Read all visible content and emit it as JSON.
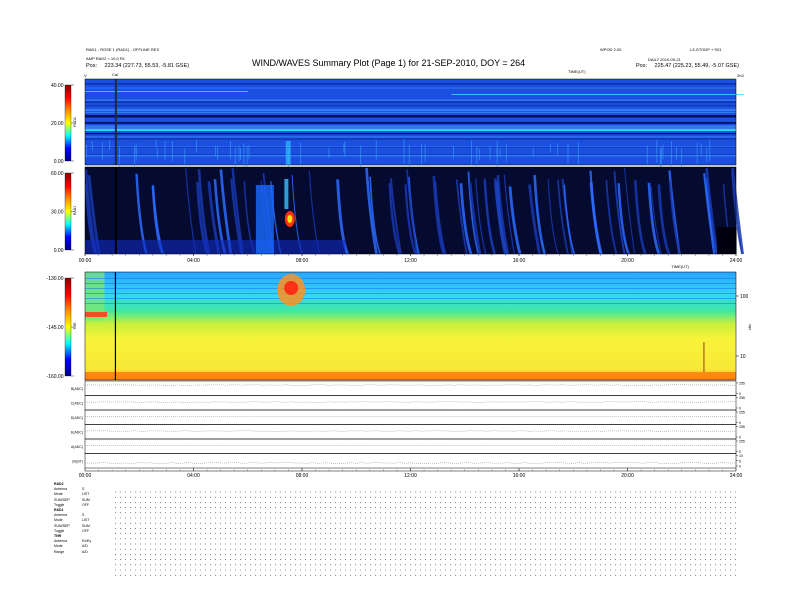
{
  "header": {
    "left_line1": "RAD1 - ROSE 1 (RAD1) - OFFLINE RES",
    "left_line2": "AMP RAD2 = 10.0 R1",
    "left_orbit_label": "Pos:",
    "left_orbit_value": "223.34 (227.73, 55.53, -5.81 GSE)",
    "title": "WIND/WAVES Summary Plot (Page 1) for 21-SEP-2010, DOY = 264",
    "right_line1": "WPOD 2.00",
    "right_line2": "DAILY 2010-09-21",
    "right_top_far": "L3-GTODP + S01",
    "right_orbit_label": "Pos:",
    "right_orbit_value": "225.47 (225.23, 55.49, -5.07 GSE)",
    "time_label": "TIME(UT)",
    "cal_marker": "Cal",
    "marker_left": "V",
    "marker_right": "2h3"
  },
  "chart_data": {
    "type": "heatmap",
    "x_range_hours": [
      0,
      24
    ],
    "x_tick_labels": [
      "00:00",
      "04:00",
      "08:00",
      "12:00",
      "16:00",
      "20:00",
      "24:00"
    ],
    "x_tick_labels_bottom": [
      "00:00",
      "04:00",
      "08:00",
      "12:00",
      "16:00",
      "20:00",
      "24:00"
    ],
    "cal_time_hours": 1.1,
    "burst_time_hours": 7.5,
    "colormap": [
      "#8b0000",
      "#ff0000",
      "#ff8c00",
      "#ffff00",
      "#00ffff",
      "#0000ff",
      "#00008b"
    ],
    "panels": [
      {
        "id": "rad2",
        "label": "RAD2",
        "color_ticks": [
          "40.00",
          "20.00",
          "0.00"
        ],
        "base_color": "#1b4fe0"
      },
      {
        "id": "rad1",
        "label": "RAD1",
        "color_ticks": [
          "60.00",
          "30.00",
          "0.00"
        ],
        "base_color": "#050a30"
      },
      {
        "id": "tnr",
        "label": "TNR",
        "color_ticks": [
          "-130.00",
          "-145.00",
          "-160.00"
        ],
        "right_ticks": [
          "100",
          "10"
        ],
        "right_axis_label": "kHz",
        "base_color": "#f5f236"
      }
    ],
    "line_panels": [
      {
        "label": "B(ADC)",
        "right_ticks": [
          "255",
          "0"
        ],
        "level": 0.72
      },
      {
        "label": "C(ADC)",
        "right_ticks": [
          "255",
          "0"
        ],
        "level": 0.55
      },
      {
        "label": "D(ADC)",
        "right_ticks": [
          "255",
          "0"
        ],
        "level": 0.55
      },
      {
        "label": "E(ADC)",
        "right_ticks": [
          "255",
          "0"
        ],
        "level": 0.55
      },
      {
        "label": "A(ADC)",
        "right_ticks": [
          "255",
          "0"
        ],
        "level": 0.55
      },
      {
        "label": "|B|(nT)",
        "right_ticks": [
          "10",
          "5",
          "0"
        ],
        "level": 0.35
      }
    ]
  },
  "mode_table": {
    "groups": [
      {
        "title": "RAD2",
        "rows": [
          {
            "label": "Antenna",
            "value": "S"
          },
          {
            "label": "Mode",
            "value": "LIST"
          },
          {
            "label": "SUM/SEP",
            "value": "SUM"
          },
          {
            "label": "Toggle",
            "value": "OFF"
          }
        ]
      },
      {
        "title": "RAD1",
        "rows": [
          {
            "label": "Antenna",
            "value": "S"
          },
          {
            "label": "Mode",
            "value": "LIST"
          },
          {
            "label": "SUM/SEP",
            "value": "SUM"
          },
          {
            "label": "Toggle",
            "value": "OFF"
          }
        ]
      },
      {
        "title": "TNR",
        "rows": [
          {
            "label": "Antenna",
            "value": "Ex/Ey"
          },
          {
            "label": "Mode",
            "value": "A/D"
          },
          {
            "label": "Range",
            "value": "A/D"
          }
        ]
      }
    ]
  }
}
